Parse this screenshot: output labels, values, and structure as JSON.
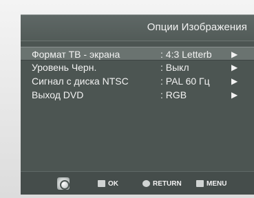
{
  "header": {
    "title": "Опции Изображения"
  },
  "menu": {
    "items": [
      {
        "label": "Формат ТВ - экрана",
        "value": ": 4:3 Letterb",
        "arrow": "▶"
      },
      {
        "label": "Уровень  Черн.",
        "value": ": Выкл",
        "arrow": "▶"
      },
      {
        "label": "Сигнал с диска NTSC",
        "value": ": PAL 60 Гц",
        "arrow": "▶"
      },
      {
        "label": "Выход DVD",
        "value": ": RGB",
        "arrow": "▶"
      }
    ]
  },
  "footer": {
    "nav_icon": "navigation-pad-icon",
    "ok_label": "OK",
    "return_label": "RETURN",
    "menu_label": "MENU"
  },
  "colors": {
    "screen_bg": "#4c5552",
    "text": "#f2f2f2",
    "selected_row": "#6a7370"
  }
}
